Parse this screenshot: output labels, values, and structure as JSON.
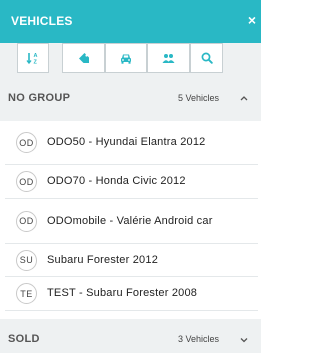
{
  "header": {
    "title": "VEHICLES",
    "close_label": "×"
  },
  "toolbar": {
    "buttons": [
      {
        "icon": "sort-az-icon"
      },
      {
        "icon": "tag-icon"
      },
      {
        "icon": "car-icon"
      },
      {
        "icon": "group-icon"
      },
      {
        "icon": "search-icon"
      }
    ]
  },
  "groups": [
    {
      "name": "NO GROUP",
      "count": "5 Vehicles",
      "expanded": true
    },
    {
      "name": "SOLD",
      "count": "3 Vehicles",
      "expanded": false
    }
  ],
  "vehicles": [
    {
      "initials": "OD",
      "name": "ODO50 - Hyundai Elantra 2012"
    },
    {
      "initials": "OD",
      "name": "ODO70 - Honda Civic 2012"
    },
    {
      "initials": "OD",
      "name": "ODOmobile - Valérie Android car"
    },
    {
      "initials": "SU",
      "name": "Subaru Forester 2012"
    },
    {
      "initials": "TE",
      "name": "TEST - Subaru Forester 2008"
    }
  ],
  "colors": {
    "header_bg": "#29b8c5",
    "accent": "#29b8c5",
    "panel_bg": "#eef1f2"
  }
}
